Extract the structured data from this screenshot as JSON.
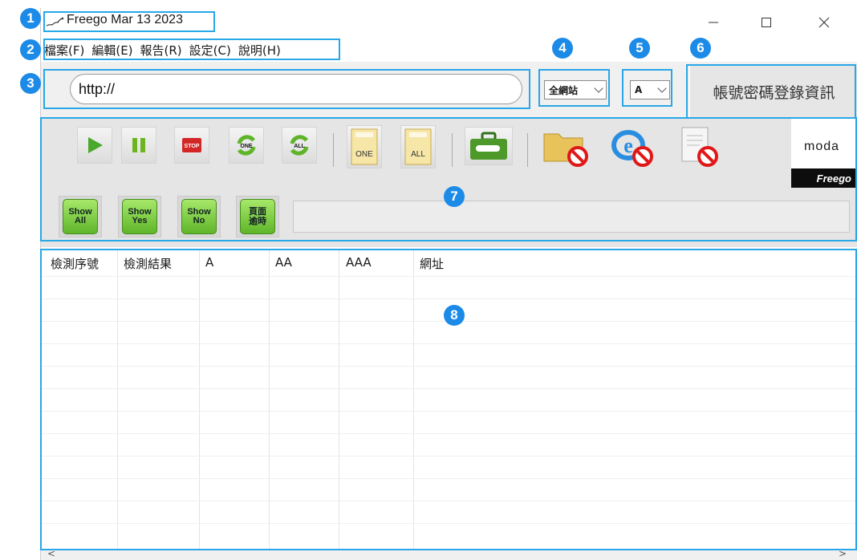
{
  "window": {
    "title": "Freego Mar 13 2023"
  },
  "menu": [
    "檔案(F)",
    "編輯(E)",
    "報告(R)",
    "設定(C)",
    "說明(H)"
  ],
  "address": {
    "value": "http://"
  },
  "scope_select": {
    "selected": "全網站"
  },
  "level_select": {
    "selected": "A"
  },
  "login_button": {
    "label": "帳號密碼登錄資訊"
  },
  "toolbar": {
    "buttons": [
      {
        "name": "start-icon"
      },
      {
        "name": "pause-icon"
      },
      {
        "name": "stop-icon",
        "label": "STOP"
      },
      {
        "name": "refresh-one-icon",
        "label": "ONE"
      },
      {
        "name": "refresh-all-icon",
        "label": "ALL"
      },
      {
        "name": "report-one-icon",
        "label": "ONE"
      },
      {
        "name": "report-all-icon",
        "label": "ALL"
      },
      {
        "name": "toolbox-icon"
      },
      {
        "name": "folder-blocked-icon"
      },
      {
        "name": "ie-blocked-icon"
      },
      {
        "name": "document-blocked-icon"
      }
    ]
  },
  "brand": {
    "moda": "moda",
    "product": "Freego"
  },
  "filters": [
    {
      "line1": "Show",
      "line2": "All"
    },
    {
      "line1": "Show",
      "line2": "Yes"
    },
    {
      "line1": "Show",
      "line2": "No"
    },
    {
      "line1": "頁面",
      "line2": "逾時"
    }
  ],
  "table": {
    "columns": [
      "檢測序號",
      "檢測結果",
      "A",
      "AA",
      "AAA",
      "網址"
    ]
  },
  "scrollbar": {
    "left": "<",
    "right": ">"
  },
  "markers": [
    "1",
    "2",
    "3",
    "4",
    "5",
    "6",
    "7",
    "8"
  ],
  "colors": {
    "marker": "#1c8be8",
    "frame": "#29a7e6",
    "green_button": "#5fb52a"
  }
}
